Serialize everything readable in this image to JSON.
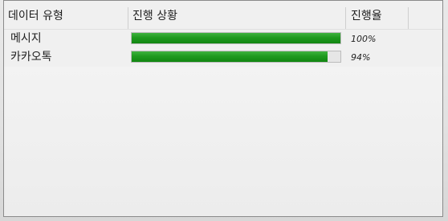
{
  "table": {
    "headers": {
      "data_type": "데이터 유형",
      "progress": "진행 상황",
      "rate": "진행율"
    },
    "rows": [
      {
        "type": "메시지",
        "progress_fraction": 1.0,
        "rate": "100%"
      },
      {
        "type": "카카오톡",
        "progress_fraction": 0.94,
        "rate": "94%"
      }
    ]
  },
  "colors": {
    "progress_fill": "#1f9a1f",
    "track": "#e6e6e6",
    "header_text": "#1e1e1e",
    "panel_border": "#8a8a8a"
  }
}
